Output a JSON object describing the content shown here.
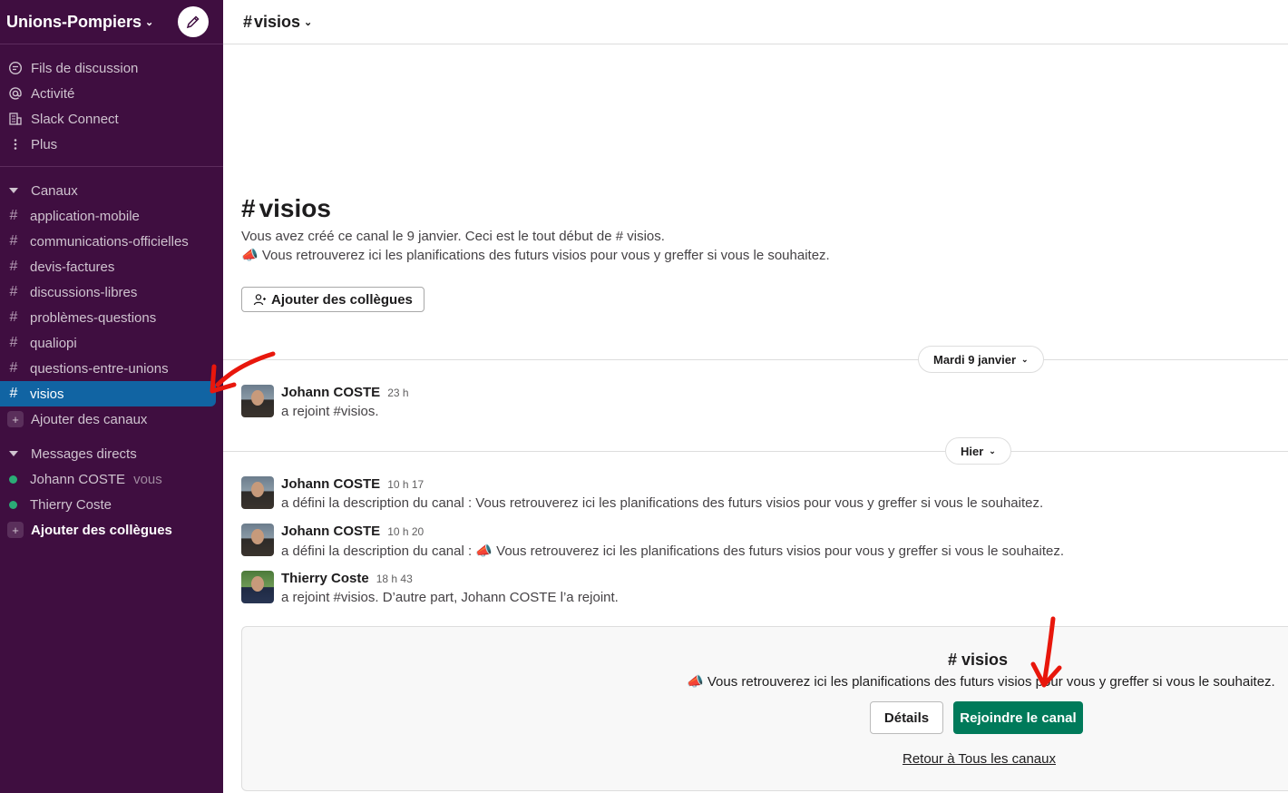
{
  "workspace": {
    "name": "Unions-Pompiers"
  },
  "nav": [
    {
      "label": "Fils de discussion",
      "icon": "threads-icon"
    },
    {
      "label": "Activité",
      "icon": "at-icon"
    },
    {
      "label": "Slack Connect",
      "icon": "building-icon"
    },
    {
      "label": "Plus",
      "icon": "more-vertical-icon"
    }
  ],
  "channels": {
    "header": "Canaux",
    "items": [
      {
        "name": "application-mobile"
      },
      {
        "name": "communications-officielles"
      },
      {
        "name": "devis-factures"
      },
      {
        "name": "discussions-libres"
      },
      {
        "name": "problèmes-questions"
      },
      {
        "name": "qualiopi"
      },
      {
        "name": "questions-entre-unions"
      },
      {
        "name": "visios",
        "active": true
      }
    ],
    "add_label": "Ajouter des canaux"
  },
  "dms": {
    "header": "Messages directs",
    "items": [
      {
        "name": "Johann COSTE",
        "suffix": "vous"
      },
      {
        "name": "Thierry Coste"
      }
    ],
    "add_label": "Ajouter des collègues"
  },
  "channel": {
    "name": "visios",
    "hash": "#",
    "intro_line1": "Vous avez créé ce canal le 9 janvier. Ceci est le tout début de # visios.",
    "intro_line2": "📣 Vous retrouverez ici les planifications des futurs visios pour vous y greffer si vous le souhaitez.",
    "add_colleagues": "Ajouter des collègues"
  },
  "dates": {
    "first": "Mardi 9 janvier",
    "second": "Hier"
  },
  "messages": [
    {
      "author": "Johann COSTE",
      "time": "23 h",
      "text": "a rejoint #visios."
    },
    {
      "author": "Johann COSTE",
      "time": "10 h 17",
      "text": "a défini la description du canal : Vous retrouverez ici les planifications des futurs visios pour vous y greffer si vous le souhaitez."
    },
    {
      "author": "Johann COSTE",
      "time": "10 h 20",
      "text": "a défini la description du canal : 📣 Vous retrouverez ici les planifications des futurs visios pour vous y greffer si vous le souhaitez."
    },
    {
      "author": "Thierry Coste",
      "time": "18 h 43",
      "text": "a rejoint #visios. D’autre part, Johann COSTE l’a rejoint."
    }
  ],
  "join_panel": {
    "title": "# visios",
    "description": "📣 Vous retrouverez ici les planifications des futurs visios pour vous y greffer si vous le souhaitez.",
    "details_label": "Détails",
    "join_label": "Rejoindre le canal",
    "back_label": "Retour à Tous les canaux"
  },
  "colors": {
    "sidebar": "#3f0e40",
    "active": "#1164a3",
    "join": "#007a5a",
    "annotation": "#e8170c"
  }
}
